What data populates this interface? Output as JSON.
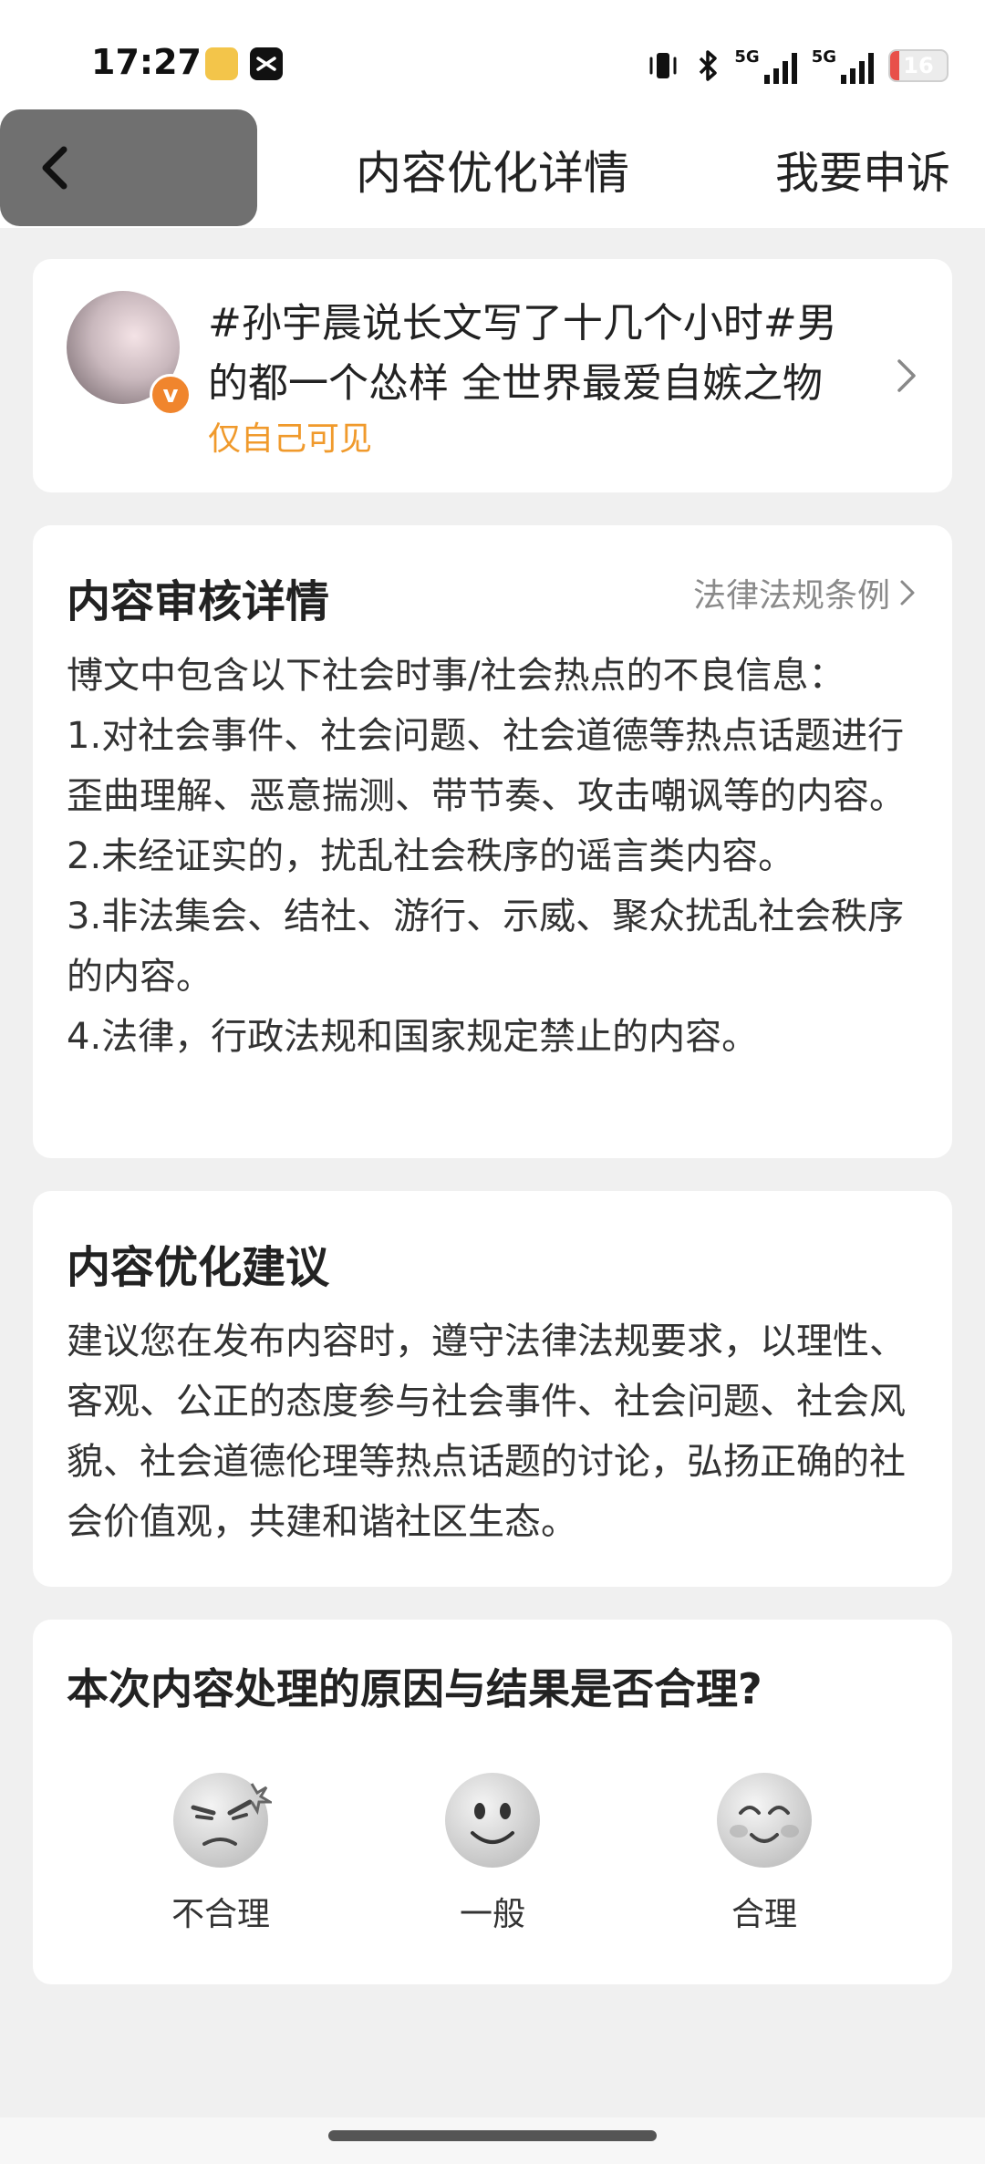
{
  "status_bar": {
    "time": "17:27",
    "battery_level": "16",
    "battery_fraction": 0.16,
    "signal_1": "5G",
    "signal_2": "5G",
    "icons": [
      "weibo-app-icon",
      "capcut-app-icon",
      "vibrate-icon",
      "bluetooth-icon",
      "signal-5g-icon",
      "signal-5g-icon",
      "battery-icon"
    ]
  },
  "header": {
    "title": "内容优化详情",
    "appeal_label": "我要申诉",
    "back_icon": "back-icon"
  },
  "post": {
    "text": "#孙宇晨说长文写了十几个小时#男的都一个怂样 全世界最爱自嫉之物",
    "visibility": "仅自己可见",
    "badge": "v",
    "accent_color": "#f09a2c"
  },
  "review": {
    "heading": "内容审核详情",
    "law_link": "法律法规条例",
    "lines": [
      "博文中包含以下社会时事/社会热点的不良信息：",
      "1.对社会事件、社会问题、社会道德等热点话题进行歪曲理解、恶意揣测、带节奏、攻击嘲讽等的内容。",
      "2.未经证实的，扰乱社会秩序的谣言类内容。",
      "3.非法集会、结社、游行、示威、聚众扰乱社会秩序的内容。",
      "4.法律，行政法规和国家规定禁止的内容。"
    ]
  },
  "suggestion": {
    "heading": "内容优化建议",
    "body": "建议您在发布内容时，遵守法律法规要求，以理性、客观、公正的态度参与社会事件、社会问题、社会风貌、社会道德伦理等热点话题的讨论，弘扬正确的社会价值观，共建和谐社区生态。"
  },
  "feedback": {
    "question": "本次内容处理的原因与结果是否合理?",
    "options": [
      {
        "label": "不合理",
        "icon": "angry-face-icon"
      },
      {
        "label": "一般",
        "icon": "neutral-face-icon"
      },
      {
        "label": "合理",
        "icon": "happy-face-icon"
      }
    ]
  }
}
